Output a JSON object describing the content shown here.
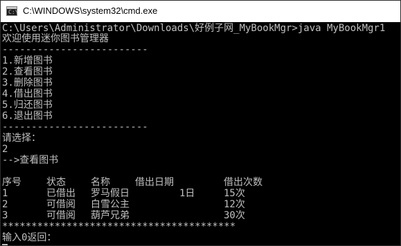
{
  "window": {
    "title": "C:\\WINDOWS\\system32\\cmd.exe",
    "icon_text": "C:\\"
  },
  "console": {
    "lines": [
      "C:\\Users\\Administrator\\Downloads\\好例子网_MyBookMgr>java MyBookMgr1",
      "欢迎使用迷你图书管理器",
      "-------------------------",
      "1.新增图书",
      "2.查看图书",
      "3.删除图书",
      "4.借出图书",
      "5.归还图书",
      "6.退出图书",
      "-------------------------",
      "请选择：",
      "2",
      "-->查看图书"
    ],
    "table": {
      "headers": [
        "序号",
        "状态",
        "名称",
        "借出日期",
        "借出次数"
      ],
      "rows": [
        [
          "1",
          "已借出",
          "罗马假日",
          "1日",
          "15次"
        ],
        [
          "2",
          "可借阅",
          "白雪公主",
          "",
          "12次"
        ],
        [
          "3",
          "可借阅",
          "葫芦兄弟",
          "",
          "30次"
        ]
      ]
    },
    "divider_stars": "****************************************",
    "prompt_back": "输入0返回："
  },
  "colors": {
    "console_bg": "#000000",
    "console_text": "#c0c0c0",
    "titlebar_bg": "#ffffff"
  }
}
